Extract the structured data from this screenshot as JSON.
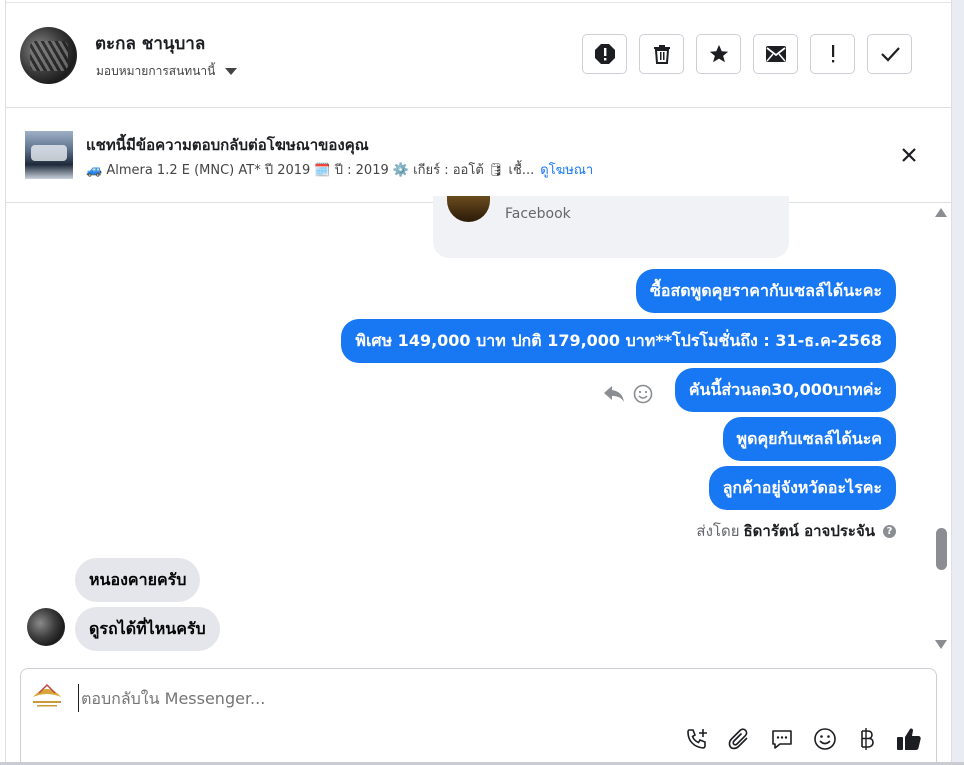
{
  "header": {
    "contact_name": "ตะกล ชานุบาล",
    "assign_label": "มอบหมายการสนทนานี้",
    "actions": [
      "spam-icon",
      "trash-icon",
      "star-icon",
      "envelope-icon",
      "follow-up-icon",
      "done-icon"
    ]
  },
  "ad_banner": {
    "title": "แชทนี้มีข้อความตอบกลับต่อโฆษณาของคุณ",
    "subtitle": "🚙 Almera 1.2 E (MNC) AT* ปี 2019 🗓️ ปี : 2019 ⚙️ เกียร์ : ออโต้ 🛢 เชื้...",
    "link": "ดูโฆษณา"
  },
  "messages": {
    "card_source": "Facebook",
    "outgoing": [
      "ซื้อสดพูดคุยราคากับเซลล์ได้นะคะ",
      "พิเศษ 149,000 บาท  ปกติ 179,000 บาท**โปรโมชั่นถึง : 31-ธ.ค-2568",
      "คันนี้ส่วนลด30,000บาทค่ะ",
      "พูดคุยกับเซลล์ได้นะค",
      "ลูกค้าอยู่จังหวัดอะไรคะ"
    ],
    "sent_by_prefix": "ส่งโดย",
    "sent_by_name": "ธิดารัตน์ อาจประจัน",
    "incoming": [
      "หนองคายครับ",
      "ดูรถได้ที่ไหนครับ"
    ]
  },
  "composer": {
    "placeholder": "ตอบกลับใน Messenger...",
    "tools": [
      "call-add-icon",
      "attach-icon",
      "saved-reply-icon",
      "emoji-icon",
      "baht-icon",
      "like-icon"
    ]
  },
  "colors": {
    "accent": "#1877f2",
    "incoming_bubble": "#e4e6eb"
  }
}
